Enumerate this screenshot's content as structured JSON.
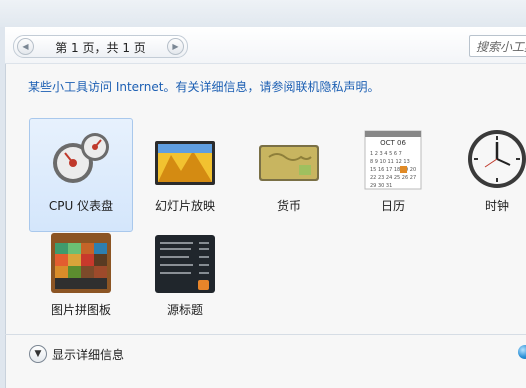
{
  "pager": {
    "prev_icon": "chevron-left-icon",
    "label": "第 1 页，共 1 页",
    "next_icon": "chevron-right-icon"
  },
  "search": {
    "placeholder": "搜索小工具"
  },
  "notice": "某些小工具访问 Internet。有关详细信息，请参阅联机隐私声明。",
  "gadgets": [
    {
      "name": "CPU 仪表盘",
      "icon": "cpu-meter-icon",
      "selected": true
    },
    {
      "name": "幻灯片放映",
      "icon": "slideshow-icon",
      "selected": false
    },
    {
      "name": "货币",
      "icon": "currency-icon",
      "selected": false
    },
    {
      "name": "日历",
      "icon": "calendar-icon",
      "selected": false
    },
    {
      "name": "时钟",
      "icon": "clock-icon",
      "selected": false
    },
    {
      "name": "图片拼图板",
      "icon": "picture-puzzle-icon",
      "selected": false
    },
    {
      "name": "源标题",
      "icon": "feed-headlines-icon",
      "selected": false
    }
  ],
  "calendar_month": "OCT 06",
  "footer": {
    "details_label": "显示详细信息"
  }
}
